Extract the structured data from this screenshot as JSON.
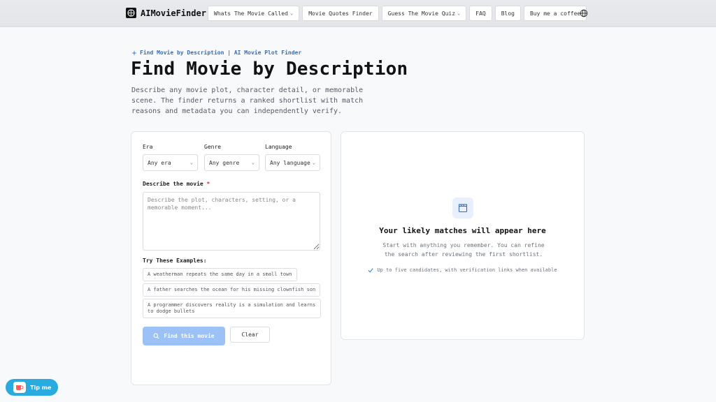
{
  "header": {
    "logo_text": "AIMovieFinder",
    "nav": [
      {
        "label": "Whats The Movie Called",
        "dropdown": true
      },
      {
        "label": "Movie Quotes Finder",
        "dropdown": false
      },
      {
        "label": "Guess The Movie Quiz",
        "dropdown": true
      },
      {
        "label": "FAQ",
        "dropdown": false
      },
      {
        "label": "Blog",
        "dropdown": false
      },
      {
        "label": "Buy me a coffee",
        "dropdown": false
      }
    ],
    "globe_icon": "globe-icon"
  },
  "hero": {
    "eyebrow": "Find Movie by Description | AI Movie Plot Finder",
    "title": "Find Movie by Description",
    "description": "Describe any movie plot, character detail, or memorable scene. The finder returns a ranked shortlist with match reasons and metadata you can independently verify."
  },
  "form": {
    "era": {
      "label": "Era",
      "value": "Any era"
    },
    "genre": {
      "label": "Genre",
      "value": "Any genre"
    },
    "language": {
      "label": "Language",
      "value": "Any language"
    },
    "describe_label": "Describe the movie",
    "required_mark": "*",
    "textarea_placeholder": "Describe the plot, characters, setting, or a memorable moment...",
    "examples_label": "Try These Examples:",
    "examples": [
      "A weatherman repeats the same day in a small town",
      "A father searches the ocean for his missing clownfish son",
      "A programmer discovers reality is a simulation and learns to dodge bullets"
    ],
    "find_label": "Find this movie",
    "clear_label": "Clear"
  },
  "results": {
    "title": "Your likely matches will appear here",
    "subtitle": "Start with anything you remember. You can refine the search after reviewing the first shortlist.",
    "note": "Up to five candidates, with verification links when available"
  },
  "tip": {
    "label": "Tip me"
  },
  "colors": {
    "accent": "#3a6fb5",
    "button_disabled": "#9bc1f7",
    "tip": "#29abe0"
  }
}
